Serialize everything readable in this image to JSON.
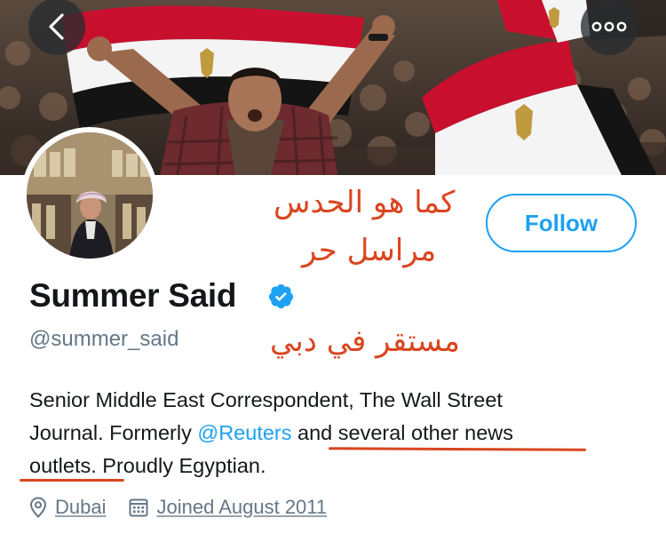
{
  "profile": {
    "display_name": "Summer Said",
    "handle": "@summer_said",
    "verified": true,
    "follow_label": "Follow"
  },
  "bio": {
    "line1": "Senior Middle East Correspondent, The Wall Street",
    "line2_prefix": "Journal. Formerly ",
    "mention": "@Reuters",
    "line2_suffix": " and several other news",
    "line3": "outlets. Proudly Egyptian."
  },
  "meta": {
    "location": "Dubai",
    "joined": "Joined August 2011"
  },
  "annotations": {
    "line1": "كما هو الحدس",
    "line2": "مراسل حر",
    "line3": "مستقر في دبي"
  },
  "icons": {
    "back": "chevron-left-icon",
    "more": "more-horizontal-icon",
    "verified": "verified-badge-icon",
    "location": "location-pin-icon",
    "calendar": "calendar-icon"
  },
  "colors": {
    "accent": "#1da1f2",
    "annotation": "#d9461f",
    "flag_red": "#c8102e",
    "flag_white": "#ffffff",
    "flag_black": "#111111",
    "flag_eagle": "#c09a3e"
  }
}
